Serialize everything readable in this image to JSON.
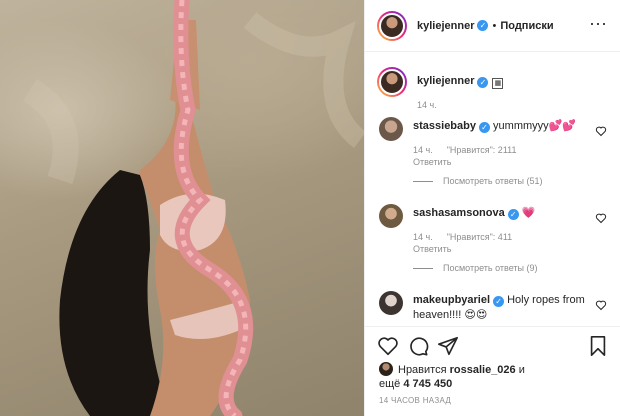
{
  "header": {
    "username": "kyliejenner",
    "separator": "•",
    "follow_label": "Подписки",
    "more_label": "···"
  },
  "caption": {
    "username": "kyliejenner",
    "emoji_icon": "framed-picture-emoji",
    "time": "14 ч."
  },
  "comments": [
    {
      "username": "stassiebaby",
      "text": "yummmyyy",
      "emoji": "💕💕",
      "time": "14 ч.",
      "likes": "\"Нравится\": 2111",
      "reply_label": "Ответить",
      "view_replies": "Посмотреть ответы (51)"
    },
    {
      "username": "sashasamsonova",
      "text": "",
      "emoji": "💗",
      "time": "14 ч.",
      "likes": "\"Нравится\": 411",
      "reply_label": "Ответить",
      "view_replies": "Посмотреть ответы (9)"
    },
    {
      "username": "makeupbyariel",
      "text": "Holy ropes from heaven!!!!",
      "emoji": "😍😍"
    }
  ],
  "likes": {
    "prefix": "Нравится",
    "user": "rossalie_026",
    "and": "и",
    "more_prefix": "ещё",
    "count": "4 745 450"
  },
  "timestamp": "14 ЧАСОВ НАЗАД",
  "colors": {
    "verified": "#3897f0",
    "border": "#efefef",
    "muted": "#8e8e8e",
    "rope": "#e08f93"
  }
}
